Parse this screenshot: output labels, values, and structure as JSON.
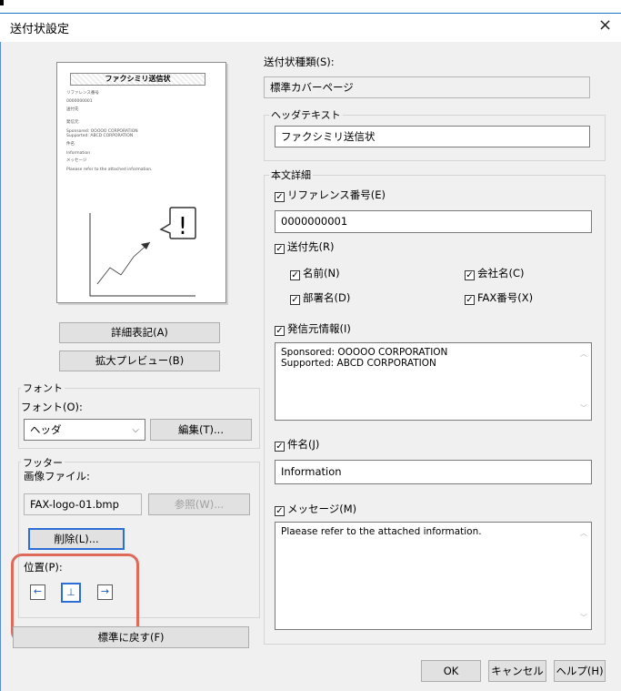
{
  "window": {
    "title": "送付状設定",
    "close_glyph": "×"
  },
  "preview": {
    "title": "ファクシミリ送信状",
    "lines": [
      "リファレンス番号",
      "0000000001",
      "送付先",
      "発信元",
      "Sponsored: OOOOO CORPORATION",
      "Supported: ABCD CORPORATION",
      "件名",
      "Information",
      "メッセージ",
      "Plaease refer to the attached information."
    ],
    "exclamation": "!"
  },
  "buttons": {
    "detail": "詳細表記(A)",
    "zoom_preview": "拡大プレビュー(B)",
    "edit": "編集(T)...",
    "browse": "参照(W)...",
    "delete": "削除(L)...",
    "reset": "標準に戻す(F)",
    "ok": "OK",
    "cancel": "キャンセル",
    "help": "ヘルプ(H)"
  },
  "font_group": {
    "label": "フォント",
    "font_label": "フォント(O):",
    "font_value": "ヘッダ"
  },
  "footer_group": {
    "label": "フッター",
    "image_label": "画像ファイル:",
    "image_value": "FAX-logo-01.bmp",
    "position_label": "位置(P):",
    "positions": [
      "←",
      "⊥",
      "→"
    ]
  },
  "cover_type": {
    "label": "送付状種類(S):",
    "value": "標準カバーページ"
  },
  "header_text": {
    "label": "ヘッダテキスト",
    "value": "ファクシミリ送信状"
  },
  "body_details": {
    "label": "本文詳細",
    "reference": {
      "label": "リファレンス番号(E)",
      "value": "0000000001"
    },
    "recipient": {
      "label": "送付先(R)"
    },
    "name": {
      "label": "名前(N)"
    },
    "company": {
      "label": "会社名(C)"
    },
    "department": {
      "label": "部署名(D)"
    },
    "fax": {
      "label": "FAX番号(X)"
    },
    "sender": {
      "label": "発信元情報(I)",
      "line1": "Sponsored: OOOOO CORPORATION",
      "line2": "Supported: ABCD CORPORATION"
    },
    "subject": {
      "label": "件名(J)",
      "value": "Information"
    },
    "message": {
      "label": "メッセージ(M)",
      "value": "Plaease refer to the attached information."
    }
  },
  "check_glyph": "✓",
  "colors": {
    "highlight": "#e06a5a",
    "accent": "#2b6fd6"
  }
}
